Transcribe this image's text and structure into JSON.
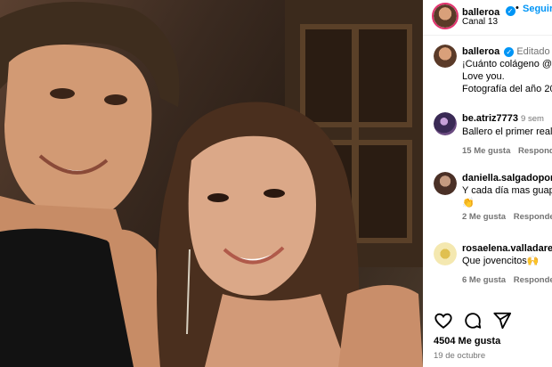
{
  "header": {
    "username": "balleroa",
    "follow_label": "Seguir",
    "separator": "•",
    "location": "Canal 13"
  },
  "caption": {
    "username": "balleroa",
    "edited": "Editado",
    "lines": [
      "¡Cuánto colágeno @",
      "Love you.",
      "Fotografía del año 20"
    ]
  },
  "comments": [
    {
      "username": "be.atriz7773",
      "time": "9 sem",
      "text": "Ballero el primer real",
      "likes": "15 Me gusta",
      "reply": "Responder"
    },
    {
      "username": "daniella.salgadopon",
      "time": "",
      "text": "Y cada día mas guap",
      "emoji": "👏",
      "likes": "2 Me gusta",
      "reply": "Responder"
    },
    {
      "username": "rosaelena.valladares",
      "time": "",
      "text": "Que jovencitos🙌",
      "likes": "6 Me gusta",
      "reply": "Responder"
    }
  ],
  "actions": {
    "like": "heart-icon",
    "comment": "comment-icon",
    "share": "share-icon"
  },
  "post": {
    "likes": "4504 Me gusta",
    "date": "19 de octubre"
  },
  "colors": {
    "accent": "#0095f6",
    "muted": "#737373",
    "ring": "#e1306c"
  }
}
